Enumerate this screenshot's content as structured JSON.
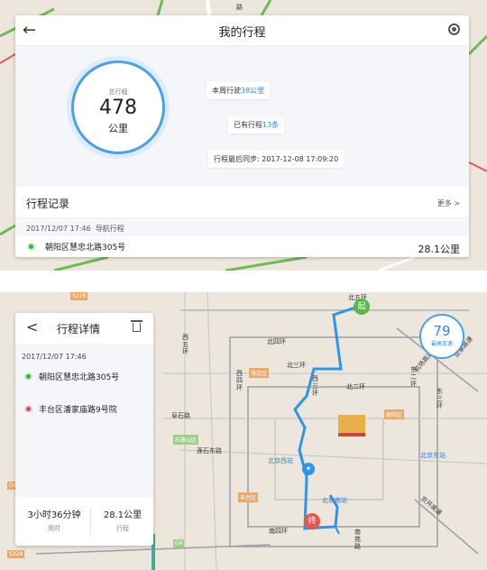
{
  "top": {
    "map_labels": [
      "路"
    ],
    "header": {
      "back_icon": "back-arrow-icon",
      "title": "我的行程",
      "settings_icon": "settings-icon"
    },
    "total": {
      "label": "总行程",
      "value": "478",
      "unit": "公里"
    },
    "week": {
      "prefix": "本周行驶",
      "value": "38公里"
    },
    "count": {
      "prefix": "已有行程",
      "value": "13条"
    },
    "sync": {
      "label": "行程最后同步:",
      "value": "2017-12-08 17:09:20"
    },
    "records": {
      "title": "行程记录",
      "more": "更多 >"
    },
    "record": {
      "date": "2017/12/07 17:46",
      "type": "导航行程",
      "address": "朝阳区慧忠北路305号",
      "distance": "28.1公里"
    }
  },
  "bottom": {
    "header": {
      "back_icon": "back-arrow-icon",
      "title": "行程详情",
      "delete_icon": "trash-icon"
    },
    "date": "2017/12/07 17:46",
    "start": "朝阳区慧忠北路305号",
    "end": "丰台区潘家庙路9号院",
    "duration": {
      "value": "3小时36分钟",
      "label": "用时"
    },
    "distance": {
      "value": "28.1公里",
      "label": "行程"
    },
    "max_speed": {
      "value": "79",
      "label": "最高车速"
    },
    "pins": {
      "start": "起",
      "end": "终"
    },
    "map": {
      "beisihuan": "北四环",
      "beisanhuan": "北三环",
      "beierhuan": "北二环",
      "xisihuan": "西四环",
      "xisanhuan": "西三环",
      "xierhuan": "西二环",
      "dongsanhuan": "东三环",
      "dongerhuan": "东二环",
      "jichang": "机场高速",
      "beiwuhuan": "北五环",
      "jingchang": "京承高速",
      "fushilu": "阜石路",
      "lianshilu": "莲石东路",
      "nansihuan": "南四环",
      "nanyuan": "南苑路",
      "suzhouzhang": "京开高速",
      "xiwuhuan": "西五环",
      "haidian": "海淀区",
      "shijingshan": "石景山区",
      "fengtai": "丰台区",
      "chaoyang": "朝阳区",
      "beijingxi": "北京西站",
      "beijingnan": "北京南站",
      "beijingdong": "北京东站",
      "g4": "G4",
      "s328": "S328",
      "s216": "S216",
      "g6": "G6"
    },
    "colors": {
      "route": "#2f95ec",
      "start_pin": "#5ab84a",
      "end_pin": "#e2574f"
    }
  }
}
